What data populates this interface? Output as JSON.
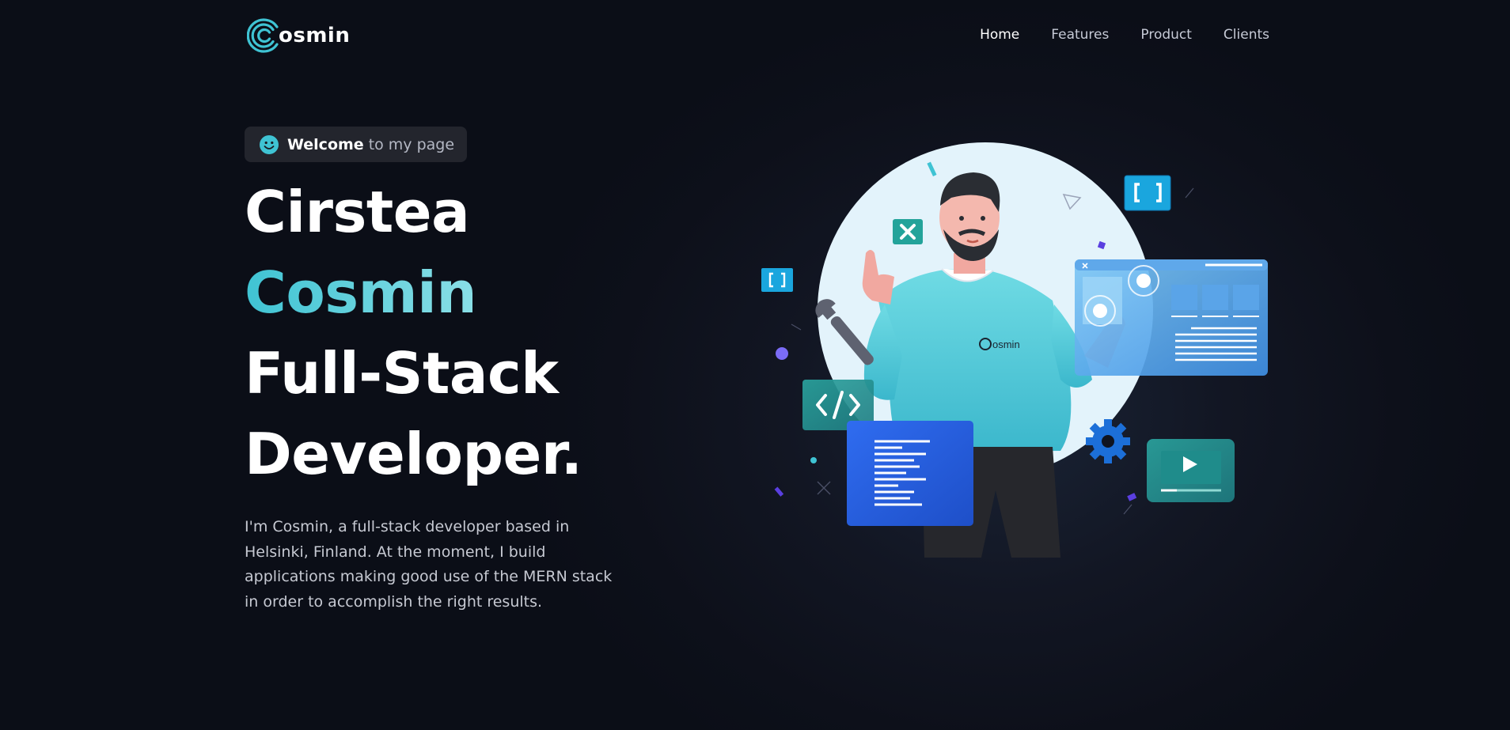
{
  "brand": {
    "name": "osmin",
    "accent_color": "#3fc3d3"
  },
  "nav": {
    "items": [
      {
        "label": "Home",
        "active": true
      },
      {
        "label": "Features",
        "active": false
      },
      {
        "label": "Product",
        "active": false
      },
      {
        "label": "Clients",
        "active": false
      }
    ]
  },
  "hero": {
    "badge": {
      "icon": "smiley-face-icon",
      "strong": "Welcome",
      "rest": "to my page"
    },
    "headline": {
      "line1": "Cirstea",
      "line2": "Cosmin",
      "line3": "Full-Stack",
      "line4": "Developer."
    },
    "bio": "I'm Cosmin, a full-stack developer based in Helsinki, Finland. At the moment, I build applications making good use of the MERN stack in order to accomplish the right results."
  },
  "illustration": {
    "shirt_logo": "osmin",
    "icons": [
      "developer-character",
      "wrench-icon",
      "code-tag-icon",
      "brackets-icon",
      "close-icon",
      "gear-icon",
      "play-video-icon",
      "browser-window-icon",
      "document-icon"
    ]
  },
  "colors": {
    "background": "#0d101a",
    "badge_bg": "#23252d",
    "text_muted": "#c6cad6",
    "teal": "#3fc3d3",
    "blue": "#2a62e0"
  }
}
